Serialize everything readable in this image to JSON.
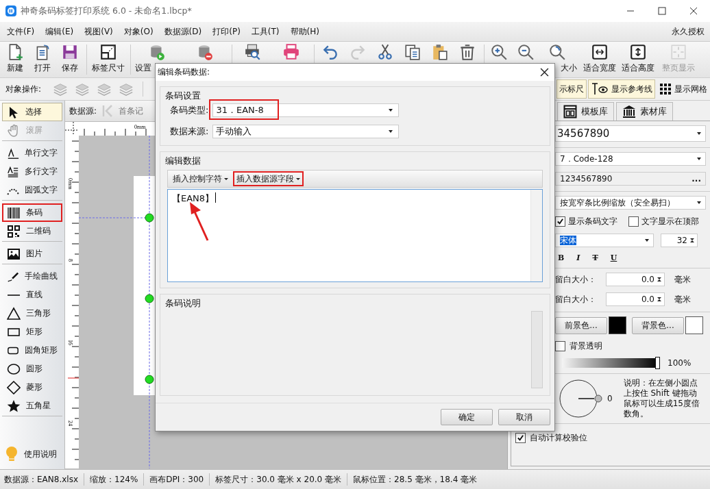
{
  "window": {
    "title": "神奇条码标签打印系统 6.0 - 未命名1.lbcp*"
  },
  "menu": {
    "items": [
      "文件(F)",
      "编辑(E)",
      "视图(V)",
      "对象(O)",
      "数据源(D)",
      "打印(P)",
      "工具(T)",
      "帮助(H)"
    ],
    "license": "永久授权"
  },
  "toolbar": {
    "groups": [
      [
        {
          "label": "新建",
          "disabled": false
        },
        {
          "label": "打开",
          "disabled": false
        },
        {
          "label": "保存",
          "disabled": false
        }
      ],
      [
        {
          "label": "标签尺寸",
          "disabled": false
        }
      ],
      [
        {
          "label": "设置",
          "disabled": false
        },
        {
          "disabled": false
        }
      ],
      [
        {
          "disabled": false
        },
        {
          "disabled": false
        }
      ],
      [
        {
          "disabled": false
        },
        {
          "disabled": true
        },
        {
          "disabled": false
        },
        {
          "disabled": false
        },
        {
          "disabled": false
        },
        {
          "disabled": false
        }
      ],
      [
        {
          "disabled": false
        },
        {
          "disabled": false
        },
        {
          "label": "大小",
          "disabled": false
        },
        {
          "label": "适合宽度",
          "disabled": false
        },
        {
          "label": "适合高度",
          "disabled": false
        },
        {
          "label": "整页显示",
          "disabled": true
        }
      ]
    ]
  },
  "object_bar": {
    "label": "对象操作:",
    "toggles": [
      {
        "label": "示标尺",
        "on": true
      },
      {
        "label": "显示参考线",
        "on": true
      },
      {
        "label": "显示网格",
        "on": false
      }
    ]
  },
  "tools": {
    "groups": [
      [
        {
          "label": "选择",
          "selected": true,
          "disabled": false,
          "highlighted": false
        },
        {
          "label": "滚屏",
          "selected": false,
          "disabled": true,
          "highlighted": false
        }
      ],
      [
        {
          "label": "单行文字",
          "selected": false,
          "disabled": false,
          "highlighted": false
        },
        {
          "label": "多行文字",
          "selected": false,
          "disabled": false,
          "highlighted": false
        },
        {
          "label": "圆弧文字",
          "selected": false,
          "disabled": false,
          "highlighted": false
        }
      ],
      [
        {
          "label": "条码",
          "selected": false,
          "disabled": false,
          "highlighted": true
        },
        {
          "label": "二维码",
          "selected": false,
          "disabled": false,
          "highlighted": false
        }
      ],
      [
        {
          "label": "图片",
          "selected": false,
          "disabled": false,
          "highlighted": false
        }
      ],
      [
        {
          "label": "手绘曲线",
          "selected": false,
          "disabled": false,
          "highlighted": false
        },
        {
          "label": "直线",
          "selected": false,
          "disabled": false,
          "highlighted": false
        },
        {
          "label": "三角形",
          "selected": false,
          "disabled": false,
          "highlighted": false
        },
        {
          "label": "矩形",
          "selected": false,
          "disabled": false,
          "highlighted": false
        },
        {
          "label": "圆角矩形",
          "selected": false,
          "disabled": false,
          "highlighted": false
        },
        {
          "label": "圆形",
          "selected": false,
          "disabled": false,
          "highlighted": false
        },
        {
          "label": "菱形",
          "selected": false,
          "disabled": false,
          "highlighted": false
        },
        {
          "label": "五角星",
          "selected": false,
          "disabled": false,
          "highlighted": false
        }
      ]
    ],
    "help": "使用说明"
  },
  "canvas": {
    "data_source_label": "数据源:",
    "first_record": "首条记",
    "top_ruler_labels": [
      "0mm"
    ],
    "left_ruler_labels": [
      "0mm",
      "8",
      "16",
      "24"
    ]
  },
  "dialog": {
    "title": "编辑条码数据:",
    "barcode_settings": {
      "title": "条码设置",
      "fields": [
        {
          "label": "条码类型:",
          "value": "31．EAN-8",
          "highlighted": true
        },
        {
          "label": "数据来源:",
          "value": "手动输入",
          "highlighted": false
        }
      ]
    },
    "edit_data": {
      "title": "编辑数据",
      "insert_buttons": [
        {
          "label": "插入控制字符",
          "highlighted": false
        },
        {
          "label": "插入数据源字段",
          "highlighted": true
        }
      ],
      "text": "【EAN8】"
    },
    "description": {
      "title": "条码说明"
    },
    "buttons": [
      "确定",
      "取消"
    ]
  },
  "properties": {
    "tabs": [
      {
        "label": "模板库",
        "selected": false
      },
      {
        "label": "素材库",
        "selected": false
      }
    ],
    "data_value": "34567890",
    "barcode_type": "7．Code-128",
    "content": "1234567890",
    "more": "...",
    "scale_mode": "按宽窄条比例缩放（安全易扫）",
    "checkboxes": [
      {
        "label": "显示条码文字",
        "checked": true
      },
      {
        "label": "文字显示在顶部",
        "checked": false
      }
    ],
    "font": "宋体",
    "font_size": "32",
    "styles": [
      "B",
      "I",
      "T",
      "U"
    ],
    "margins": [
      {
        "label": "留白大小：",
        "value": "0.0",
        "unit": "毫米"
      },
      {
        "label": "留白大小：",
        "value": "0.0",
        "unit": "毫米"
      }
    ],
    "colors": [
      {
        "label": "前景色...",
        "color": "#000000"
      },
      {
        "label": "背景色...",
        "color": "#ffffff"
      }
    ],
    "transparent": {
      "label": "背景透明",
      "checked": false
    },
    "opacity": {
      "level": 1,
      "reading": "100%"
    },
    "rotation": {
      "reading": "0",
      "note": "说明：在左侧小圆点上按住 Shift 键拖动鼠标可以生成15度倍数角。"
    },
    "auto_check": {
      "label": "自动计算校验位",
      "checked": true
    }
  },
  "status_bar": [
    "数据源：EAN8.xlsx",
    "缩放：124%",
    "画布DPI：300",
    "标签尺寸：30.0 毫米 x 20.0 毫米",
    "鼠标位置：28.5 毫米，18.4 毫米"
  ]
}
